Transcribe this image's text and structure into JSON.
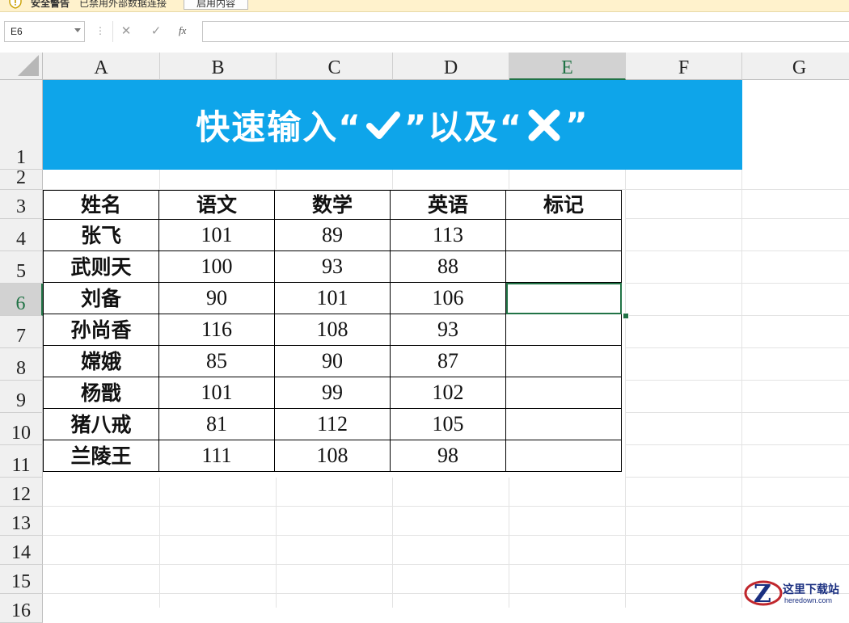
{
  "security_bar": {
    "title": "安全警告",
    "message": "已禁用外部数据连接",
    "enable_button": "启用内容"
  },
  "formula_bar": {
    "name_box": "E6",
    "separator": "⋮",
    "cancel_icon": "✕",
    "enter_icon": "✓",
    "fx_label": "fx",
    "formula_value": ""
  },
  "columns": [
    "A",
    "B",
    "C",
    "D",
    "E",
    "F",
    "G"
  ],
  "rows": [
    "1",
    "2",
    "3",
    "4",
    "5",
    "6",
    "7",
    "8",
    "9",
    "10",
    "11",
    "12",
    "13",
    "14",
    "15",
    "16"
  ],
  "selected_cell": "E6",
  "banner": {
    "text_before": "快速输入“",
    "text_middle": "”以及“",
    "text_after": "”",
    "check_icon": "check-mark-icon",
    "cross_icon": "cross-mark-icon",
    "background_color": "#0ea5ea"
  },
  "table": {
    "headers": [
      "姓名",
      "语文",
      "数学",
      "英语",
      "标记"
    ],
    "rows": [
      [
        "张飞",
        "101",
        "89",
        "113",
        ""
      ],
      [
        "武则天",
        "100",
        "93",
        "88",
        ""
      ],
      [
        "刘备",
        "90",
        "101",
        "106",
        ""
      ],
      [
        "孙尚香",
        "116",
        "108",
        "93",
        ""
      ],
      [
        "嫦娥",
        "85",
        "90",
        "87",
        ""
      ],
      [
        "杨戬",
        "101",
        "99",
        "102",
        ""
      ],
      [
        "猪八戒",
        "81",
        "112",
        "105",
        ""
      ],
      [
        "兰陵王",
        "111",
        "108",
        "98",
        ""
      ]
    ]
  },
  "watermark": {
    "title": "这里下载站",
    "subtitle": "heredown.com"
  },
  "colors": {
    "accent_green": "#217346",
    "banner_blue": "#0ea5ea"
  }
}
